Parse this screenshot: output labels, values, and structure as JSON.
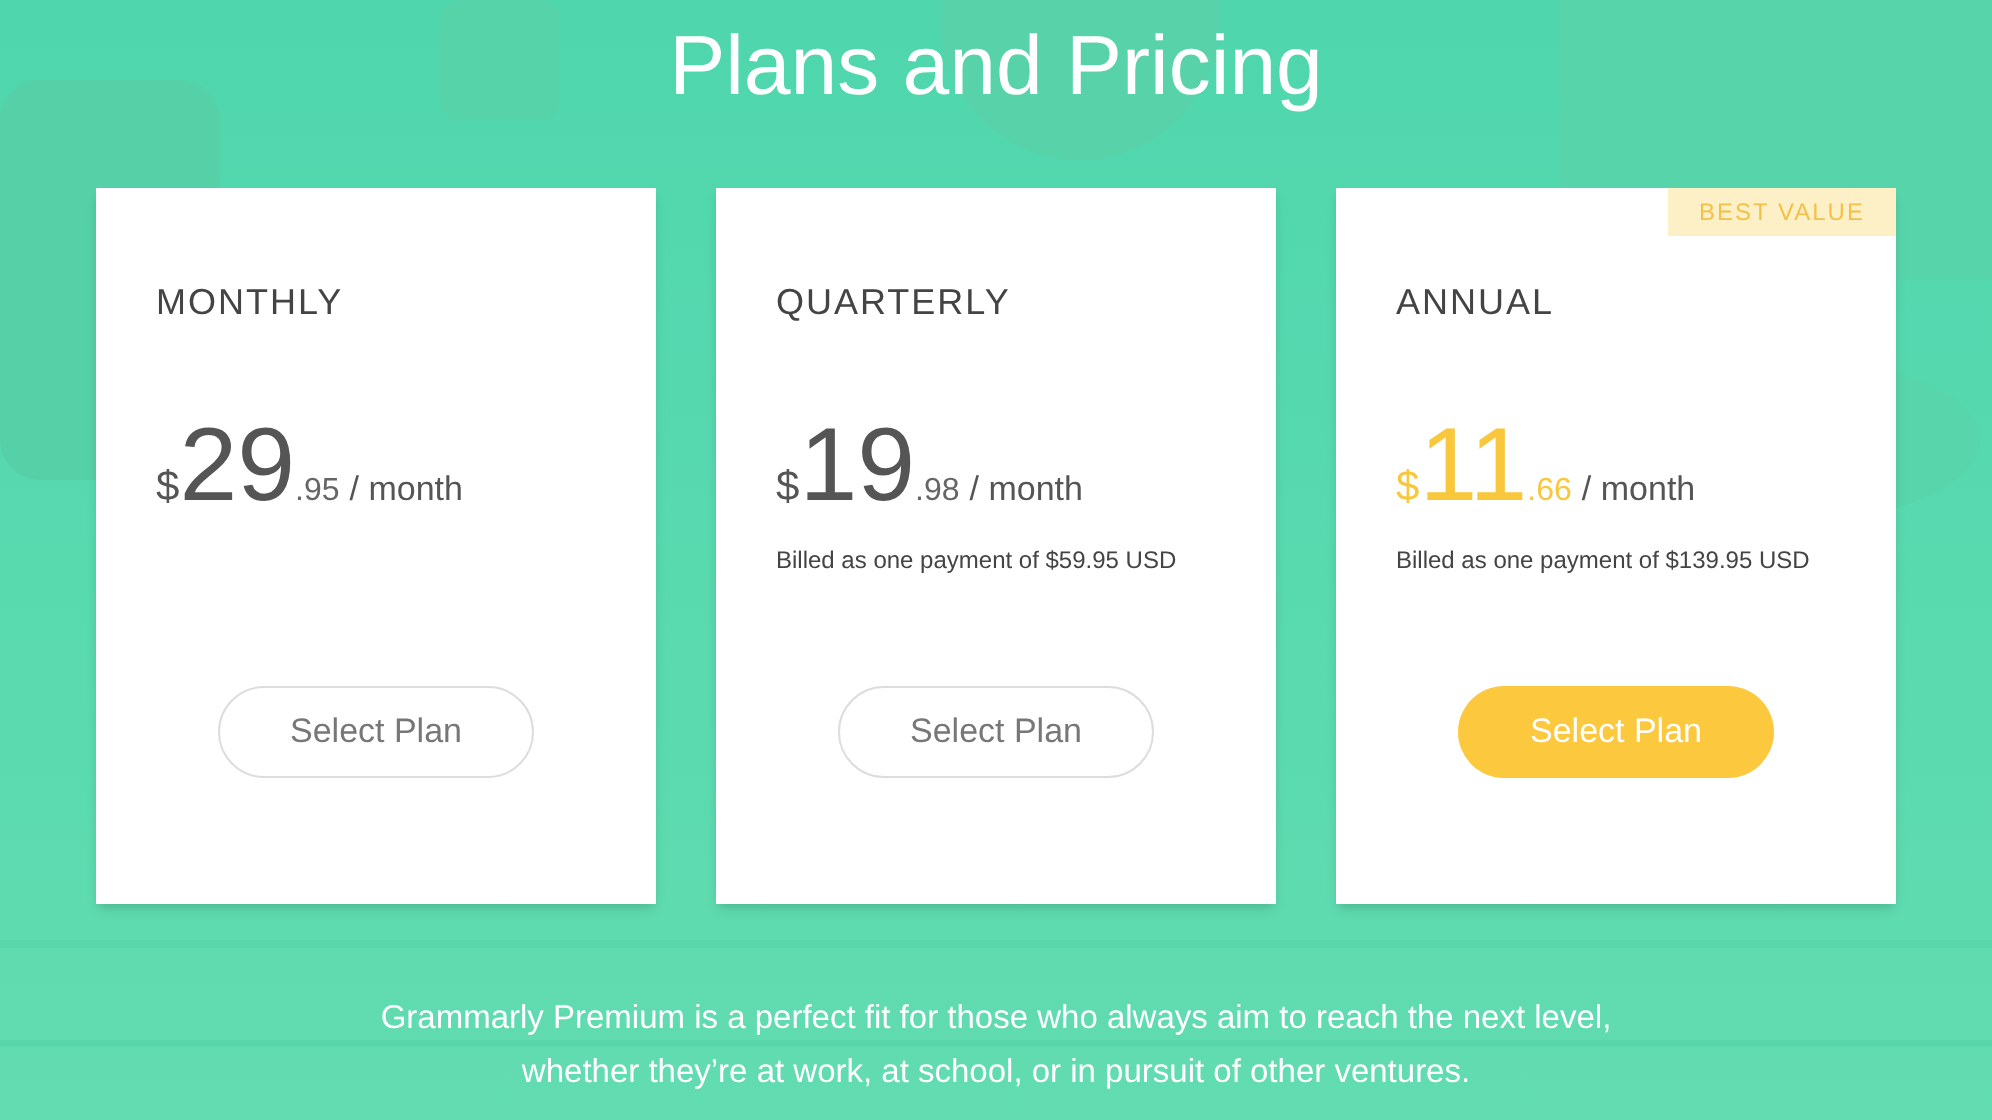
{
  "title": "Plans and Pricing",
  "plans": [
    {
      "name": "MONTHLY",
      "currency": "$",
      "price_whole": "29",
      "price_cents": ".95",
      "period": "/ month",
      "button": "Select Plan",
      "highlighted": false
    },
    {
      "name": "QUARTERLY",
      "currency": "$",
      "price_whole": "19",
      "price_cents": ".98",
      "period": "/ month",
      "billing": "Billed as one payment of $59.95 USD",
      "button": "Select Plan",
      "highlighted": false
    },
    {
      "name": "ANNUAL",
      "badge": "BEST VALUE",
      "currency": "$",
      "price_whole": "11",
      "price_cents": ".66",
      "period": "/ month",
      "billing": "Billed as one payment of $139.95 USD",
      "button": "Select Plan",
      "highlighted": true
    }
  ],
  "footer_text": "Grammarly Premium is a perfect fit for those who always aim to reach the next level, whether they’re at work, at school, or in pursuit of other ventures."
}
